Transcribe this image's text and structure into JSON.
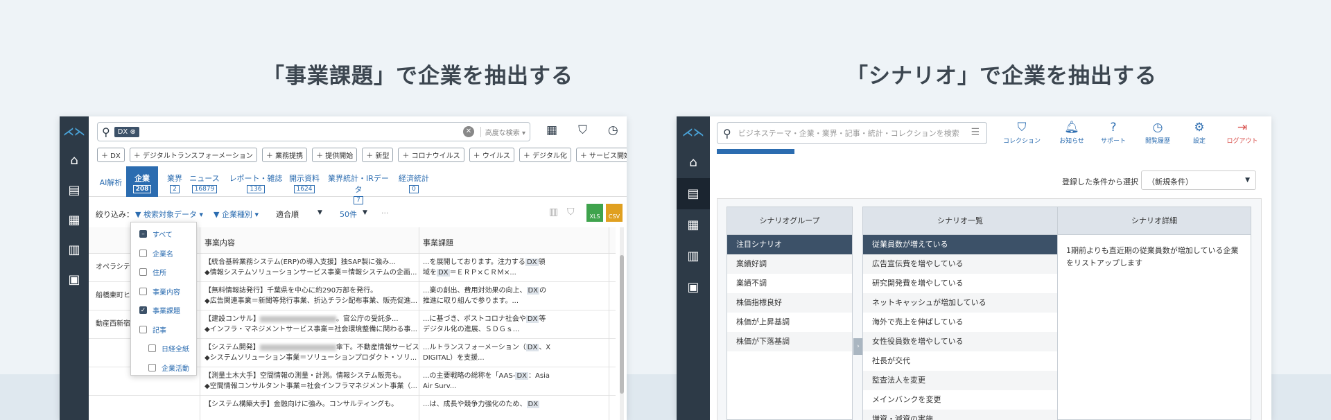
{
  "headings": {
    "left": "「事業課題」で企業を抽出する",
    "right": "「シナリオ」で企業を抽出する"
  },
  "left_app": {
    "search": {
      "chip": "DX ⊗",
      "advanced": "高度な検索 ▾"
    },
    "tags": [
      "＋ DX",
      "＋ デジタルトランスフォーメーション",
      "＋ 業務提携",
      "＋ 提供開始",
      "＋ 新型",
      "＋ コロナウイルス",
      "＋ ウイルス",
      "＋ デジタル化",
      "＋ サービス開始",
      "＋"
    ],
    "tabs": [
      {
        "label": "AI解析",
        "count": ""
      },
      {
        "label": "企業",
        "count": "208"
      },
      {
        "label": "業界",
        "count": "2"
      },
      {
        "label": "ニュース",
        "count": "16879"
      },
      {
        "label": "レポート・雑誌",
        "count": "136"
      },
      {
        "label": "開示資料",
        "count": "1624"
      },
      {
        "label": "業界統計・IRデータ",
        "count": "7"
      },
      {
        "label": "経済統計",
        "count": "0"
      }
    ],
    "filter": {
      "label": "絞り込み：",
      "target": "▼ 検索対象データ ▾",
      "type": "▼ 企業種別 ▾",
      "sort": "適合順",
      "sort_caret": "▼",
      "perpage": "50件",
      "perpage_caret": "▼",
      "more": "···",
      "xls": "XLS",
      "csv": "CSV"
    },
    "table_headers": {
      "content": "事業内容",
      "issue": "事業課題"
    },
    "rows": [
      {
        "company": "オペラシテ",
        "c1": "【統合基幹業務システム(ERP)の導入支援】独SAP製に強み...",
        "c2": "◆情報システムソリューションサービス事業＝情報システムの企画...",
        "i1a": "...を展開しております。注力する",
        "i1b": "領",
        "i2a": "域を",
        "i2b": "＝ＥＲＰ×ＣＲＭ×..."
      },
      {
        "company": "船橋東町ヒ",
        "c1": "【無料情報誌発行】千葉県を中心に約290万部を発行。",
        "c2": "◆広告関連事業＝新聞等発行事業、折込チラシ配布事業、販売促進...",
        "i1a": "...業の創出、費用対効果の向上、",
        "i1b": "の",
        "i2a": "推進に取り組んで参ります。...",
        "i2b": ""
      },
      {
        "company": "動産西新宿",
        "c1a": "【建設コンサル】",
        "c1b": "。官公庁の受託多...",
        "c2": "◆インフラ・マネジメントサービス事業＝社会環境整備に関わる事...",
        "i1a": "...に基づき、ポストコロナ社会や",
        "i1b": "等",
        "i2a": "デジタル化の進展、ＳＤＧｓ...",
        "i2b": ""
      },
      {
        "company": "",
        "c1a": "【システム開発】",
        "c1b": "傘下。不動産情報サービス...",
        "c2": "◆システムソリューション事業＝ソリューションプロダクト・ソリ...",
        "i1a": "...ルトランスフォーメーション（",
        "i1b": "、X",
        "i2a": "DIGITAL）を支援...",
        "i2b": ""
      },
      {
        "company": "",
        "c1": "【測量土木大手】空間情報の測量・計測。情報システム販売も。",
        "c2": "◆空間情報コンサルタント事業＝社会インフラマネジメント事業（...",
        "i1a": "...の主要戦略の総称を「AAS-",
        "i1b": "：Asia",
        "i2a": "Air Surv...",
        "i2b": ""
      },
      {
        "company": "",
        "c1": "【システム構築大手】金融向けに強み。コンサルティングも。",
        "c2": "",
        "i1a": "...は、成長や競争力強化のため、",
        "i1b": "",
        "i2a": "",
        "i2b": ""
      }
    ],
    "hl": "DX",
    "dropdown": [
      {
        "label": "すべて",
        "state": "partial",
        "sub": false
      },
      {
        "label": "企業名",
        "state": "off",
        "sub": false
      },
      {
        "label": "住所",
        "state": "off",
        "sub": false
      },
      {
        "label": "事業内容",
        "state": "off",
        "sub": false
      },
      {
        "label": "事業課題",
        "state": "on",
        "sub": false
      },
      {
        "label": "記事",
        "state": "off",
        "sub": false
      },
      {
        "label": "日経全紙",
        "state": "off",
        "sub": true
      },
      {
        "label": "企業活動",
        "state": "off",
        "sub": true
      }
    ]
  },
  "right_app": {
    "search_placeholder": "ビジネステーマ・企業・業界・記事・統計・コレクションを検索",
    "topnav": [
      "コレクション",
      "お知らせ",
      "サポート",
      "閲覧履歴",
      "設定",
      "ログアウト"
    ],
    "cond_label": "登録した条件から選択",
    "cond_value": "（新規条件）",
    "group_header": "シナリオグループ",
    "groups": [
      "注目シナリオ",
      "業績好調",
      "業績不調",
      "株価指標良好",
      "株価が上昇基調",
      "株価が下落基調"
    ],
    "list_header": "シナリオ一覧",
    "scenarios": [
      "従業員数が増えている",
      "広告宣伝費を増やしている",
      "研究開発費を増やしている",
      "ネットキャッシュが増加している",
      "海外で売上を伸ばしている",
      "女性役員数を増やしている",
      "社長が交代",
      "監査法人を変更",
      "メインバンクを変更",
      "増資・減資の実施"
    ],
    "detail_header": "シナリオ詳細",
    "detail_text": "1期前よりも直近期の従業員数が増加している企業をリストアップします"
  }
}
